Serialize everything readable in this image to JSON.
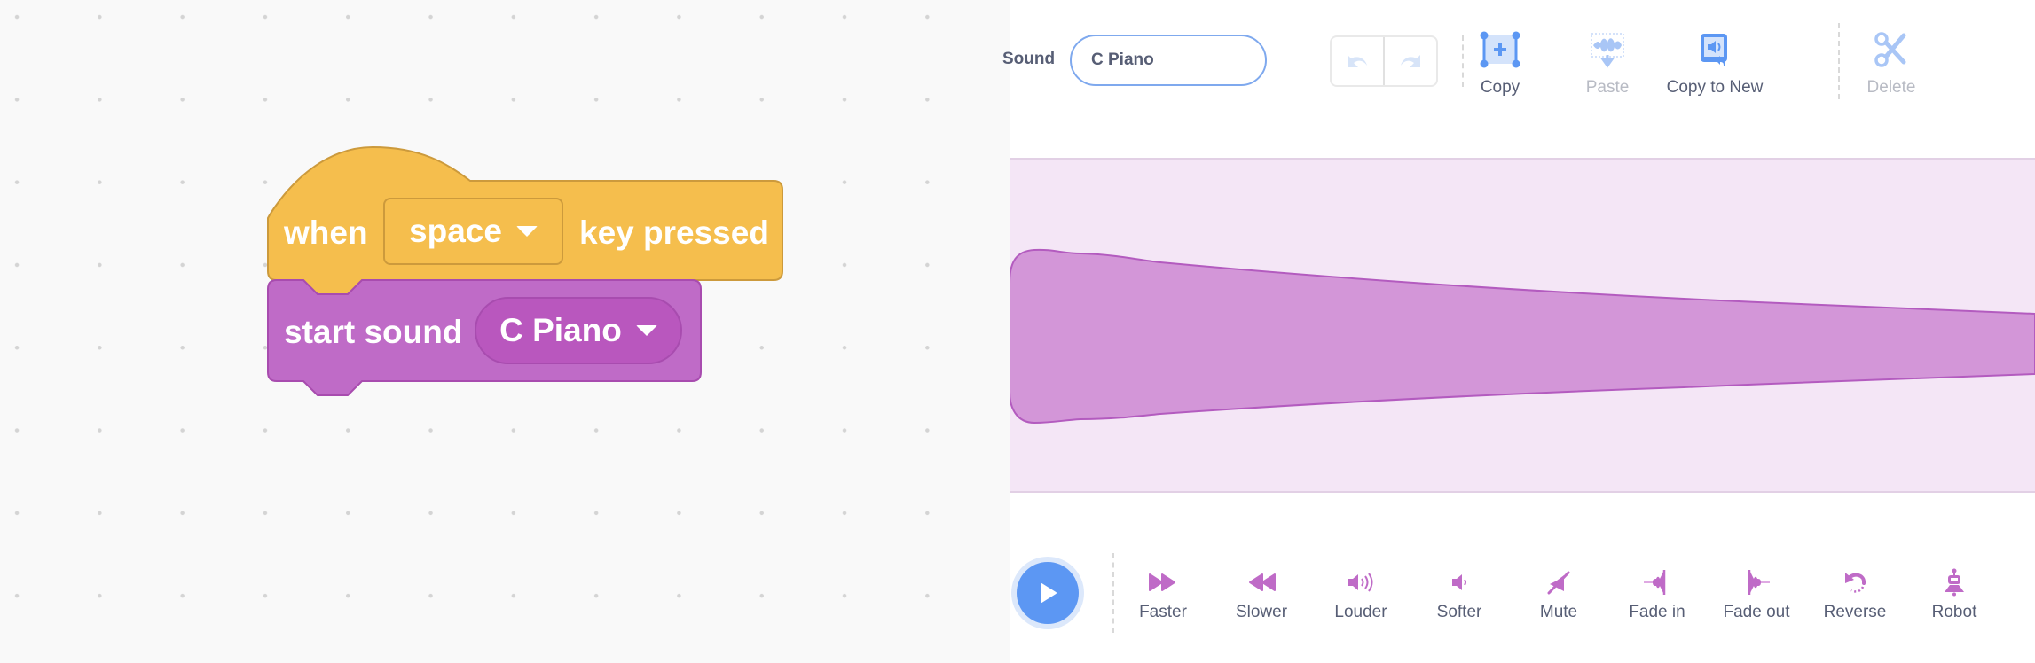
{
  "workspace": {
    "hat_block": {
      "prefix": "when",
      "key_value": "space",
      "suffix": "key pressed",
      "color": "#f5be4d",
      "border_color": "#cc9a3c"
    },
    "sound_block": {
      "label": "start sound",
      "sound_value": "C Piano",
      "color": "#bf6bc7",
      "border_color": "#a84caf"
    }
  },
  "editor": {
    "sound_label": "Sound",
    "sound_name": "C Piano",
    "undo_icon": "undo-icon",
    "redo_icon": "redo-icon",
    "toolbar": [
      {
        "label": "Copy",
        "icon": "copy-icon",
        "enabled": true
      },
      {
        "label": "Paste",
        "icon": "paste-icon",
        "enabled": false
      },
      {
        "label": "Copy to New",
        "icon": "copy-to-new-icon",
        "enabled": true
      },
      {
        "label": "Delete",
        "icon": "scissors-icon",
        "enabled": false
      }
    ],
    "waveform": {
      "fill": "#d396d8",
      "stroke": "#b35bbf",
      "background": "#f4e6f6"
    },
    "play_icon": "play-icon",
    "effects": [
      {
        "label": "Faster",
        "icon": "fast-forward-icon"
      },
      {
        "label": "Slower",
        "icon": "rewind-icon"
      },
      {
        "label": "Louder",
        "icon": "volume-up-icon"
      },
      {
        "label": "Softer",
        "icon": "volume-down-icon"
      },
      {
        "label": "Mute",
        "icon": "mute-icon"
      },
      {
        "label": "Fade in",
        "icon": "fade-in-icon"
      },
      {
        "label": "Fade out",
        "icon": "fade-out-icon"
      },
      {
        "label": "Reverse",
        "icon": "reverse-icon"
      },
      {
        "label": "Robot",
        "icon": "robot-icon"
      }
    ],
    "accent_color": "#5c97f3",
    "effect_icon_color": "#bf6bc7"
  }
}
